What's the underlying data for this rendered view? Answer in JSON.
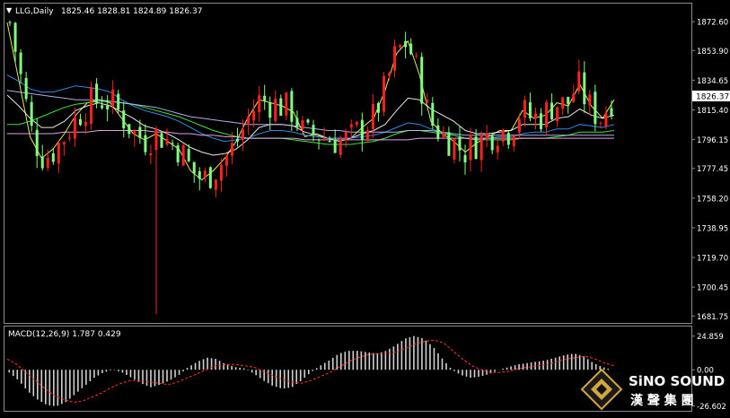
{
  "header": {
    "symbol": "LLG,Daily",
    "ohlc": "1825.46 1828.81 1824.89 1826.37"
  },
  "macd_header": {
    "label": "MACD(12,26,9) 1.787 0.429"
  },
  "logo": {
    "name_en": "SiNO SOUND",
    "name_zh": "漢 聲 集 團"
  },
  "colors": {
    "background": "#000000",
    "up": "#ff2020",
    "down": "#80ff80",
    "price_tag_bg": "#ffffff",
    "signal": "#ff3030"
  },
  "chart_data": [
    {
      "type": "candlestick",
      "title": "LLG,Daily",
      "y_ticks": [
        "1872.60",
        "1853.90",
        "1834.65",
        "1815.40",
        "1796.15",
        "1777.45",
        "1758.20",
        "1738.95",
        "1719.70",
        "1700.45",
        "1681.75"
      ],
      "ylim": [
        1679,
        1882
      ],
      "current_price": "1826.37",
      "moving_averages": [
        {
          "color": "#ffff60",
          "values": [
            1872,
            1835,
            1798,
            1784,
            1790,
            1800,
            1812,
            1820,
            1822,
            1820,
            1810,
            1800,
            1796,
            1800,
            1795,
            1790,
            1776,
            1770,
            1776,
            1784,
            1795,
            1810,
            1822,
            1820,
            1818,
            1814,
            1798,
            1800,
            1797,
            1795,
            1797,
            1804,
            1810,
            1828,
            1852,
            1860,
            1838,
            1808,
            1800,
            1795,
            1788,
            1794,
            1798,
            1802,
            1802,
            1815,
            1810,
            1812,
            1820,
            1818,
            1832,
            1818,
            1810,
            1822
          ]
        },
        {
          "color": "#ffffff",
          "values": [
            1825,
            1818,
            1810,
            1804,
            1804,
            1808,
            1815,
            1818,
            1820,
            1818,
            1814,
            1810,
            1805,
            1803,
            1800,
            1796,
            1791,
            1788,
            1786,
            1787,
            1790,
            1796,
            1804,
            1806,
            1806,
            1805,
            1801,
            1799,
            1797,
            1797,
            1797,
            1800,
            1802,
            1806,
            1815,
            1823,
            1822,
            1816,
            1812,
            1808,
            1802,
            1800,
            1800,
            1801,
            1802,
            1806,
            1806,
            1806,
            1810,
            1811,
            1816,
            1812,
            1810,
            1812
          ]
        },
        {
          "color": "#3399ff",
          "values": [
            1838,
            1834,
            1829,
            1827,
            1827,
            1829,
            1831,
            1830,
            1829,
            1827,
            1822,
            1818,
            1815,
            1813,
            1811,
            1808,
            1804,
            1800,
            1797,
            1795,
            1796,
            1797,
            1800,
            1802,
            1802,
            1801,
            1799,
            1798,
            1797,
            1797,
            1797,
            1798,
            1799,
            1801,
            1804,
            1807,
            1806,
            1803,
            1801,
            1799,
            1797,
            1796,
            1797,
            1798,
            1798,
            1800,
            1801,
            1801,
            1803,
            1803,
            1806,
            1805,
            1804,
            1806
          ]
        },
        {
          "color": "#40ff40",
          "values": [
            1806,
            1806,
            1808,
            1811,
            1814,
            1817,
            1819,
            1820,
            1821,
            1821,
            1820,
            1819,
            1817,
            1815,
            1813,
            1811,
            1808,
            1805,
            1802,
            1800,
            1798,
            1797,
            1797,
            1797,
            1797,
            1796,
            1795,
            1794,
            1793,
            1793,
            1793,
            1794,
            1795,
            1797,
            1800,
            1802,
            1802,
            1801,
            1800,
            1799,
            1797,
            1796,
            1796,
            1796,
            1796,
            1797,
            1797,
            1797,
            1798,
            1799,
            1801,
            1801,
            1801,
            1802
          ]
        },
        {
          "color": "#c0c0ff",
          "values": [
            1828,
            1827,
            1826,
            1825,
            1824,
            1823,
            1822,
            1822,
            1822,
            1821,
            1820,
            1819,
            1818,
            1817,
            1815,
            1813,
            1811,
            1810,
            1809,
            1808,
            1807,
            1806,
            1806,
            1806,
            1806,
            1805,
            1804,
            1803,
            1802,
            1802,
            1801,
            1801,
            1801,
            1801,
            1801,
            1802,
            1802,
            1802,
            1801,
            1800,
            1799,
            1799,
            1799,
            1799,
            1799,
            1799,
            1799,
            1799,
            1799,
            1799,
            1799,
            1799,
            1799,
            1799
          ]
        },
        {
          "color": "#ffb0ff",
          "values": [
            1800,
            1800,
            1800,
            1800,
            1800,
            1801,
            1801,
            1801,
            1802,
            1802,
            1802,
            1802,
            1802,
            1801,
            1801,
            1800,
            1800,
            1799,
            1799,
            1798,
            1798,
            1797,
            1797,
            1797,
            1797,
            1797,
            1796,
            1796,
            1796,
            1796,
            1796,
            1796,
            1796,
            1796,
            1796,
            1796,
            1797,
            1797,
            1797,
            1797,
            1797,
            1797,
            1797,
            1797,
            1797,
            1797,
            1797,
            1797,
            1797,
            1797,
            1797,
            1797,
            1797,
            1797
          ]
        }
      ]
    },
    {
      "type": "bar",
      "title": "MACD(12,26,9) 1.787 0.429",
      "y_ticks": [
        "24.859",
        "0.00",
        "-26.602"
      ],
      "ylim": [
        -29,
        28
      ],
      "macd_values": [
        -2,
        -8,
        -16,
        -22,
        -26,
        -27,
        -24,
        -18,
        -12,
        -6,
        -2,
        0,
        -2,
        -6,
        -10,
        -13,
        -11,
        -8,
        -4,
        2,
        6,
        9,
        8,
        4,
        2,
        1,
        -3,
        -8,
        -12,
        -14,
        -13,
        -8,
        -2,
        3,
        7,
        12,
        14,
        14,
        13,
        12,
        14,
        18,
        23,
        25,
        23,
        17,
        8,
        0,
        -4,
        -6,
        -5,
        -3,
        0,
        2,
        4,
        5,
        6,
        7,
        9,
        11,
        12,
        10,
        5,
        2,
        0
      ],
      "signal_values": [
        8,
        4,
        -2,
        -8,
        -14,
        -19,
        -22,
        -24,
        -23,
        -20,
        -17,
        -13,
        -10,
        -8,
        -8,
        -9,
        -10,
        -11,
        -9,
        -6,
        -3,
        0,
        3,
        4,
        4,
        3,
        2,
        -1,
        -4,
        -7,
        -9,
        -10,
        -8,
        -5,
        -2,
        2,
        6,
        9,
        11,
        12,
        12,
        13,
        16,
        19,
        21,
        22,
        20,
        14,
        8,
        3,
        0,
        -2,
        -2,
        -1,
        1,
        2,
        3,
        4,
        6,
        8,
        9,
        10,
        8,
        5,
        3
      ]
    }
  ]
}
